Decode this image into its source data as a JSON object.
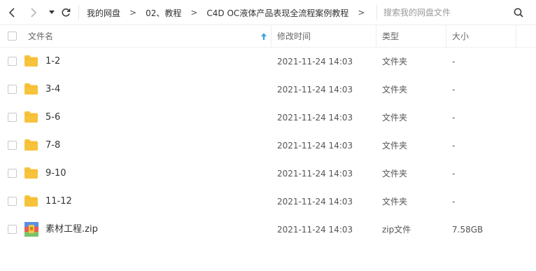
{
  "toolbar": {
    "back_icon": "chevron-left-icon",
    "forward_icon": "chevron-right-icon",
    "history_icon": "caret-down-icon",
    "refresh_icon": "refresh-icon",
    "breadcrumb": [
      "我的网盘",
      "02、教程",
      "C4D OC液体产品表现全流程案例教程"
    ],
    "breadcrumb_separator": ">",
    "search_placeholder": "搜索我的网盘文件",
    "search_icon": "search-icon"
  },
  "columns": {
    "name": "文件名",
    "modified": "修改时间",
    "type": "类型",
    "size": "大小",
    "sort_indicator": "sort-ascending-icon"
  },
  "files": [
    {
      "name": "1-2",
      "modified": "2021-11-24 14:03",
      "type": "文件夹",
      "size": "-",
      "icon": "folder-icon"
    },
    {
      "name": "3-4",
      "modified": "2021-11-24 14:03",
      "type": "文件夹",
      "size": "-",
      "icon": "folder-icon"
    },
    {
      "name": "5-6",
      "modified": "2021-11-24 14:03",
      "type": "文件夹",
      "size": "-",
      "icon": "folder-icon"
    },
    {
      "name": "7-8",
      "modified": "2021-11-24 14:03",
      "type": "文件夹",
      "size": "-",
      "icon": "folder-icon"
    },
    {
      "name": "9-10",
      "modified": "2021-11-24 14:03",
      "type": "文件夹",
      "size": "-",
      "icon": "folder-icon"
    },
    {
      "name": "11-12",
      "modified": "2021-11-24 14:03",
      "type": "文件夹",
      "size": "-",
      "icon": "folder-icon"
    },
    {
      "name": "素材工程.zip",
      "modified": "2021-11-24 14:03",
      "type": "zip文件",
      "size": "7.58GB",
      "icon": "zip-archive-icon"
    }
  ],
  "colors": {
    "folder": "#f7c33c",
    "sort_arrow": "#3aa5e4",
    "text": "#333333",
    "muted": "#666666"
  }
}
